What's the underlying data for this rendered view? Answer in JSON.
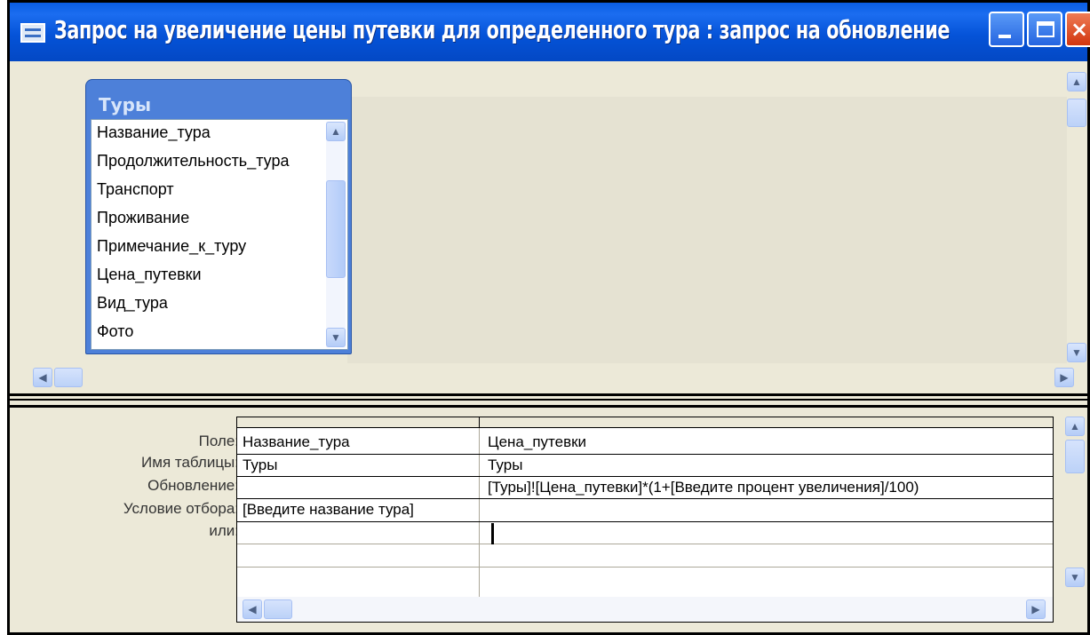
{
  "window": {
    "title": "Запрос на увеличение цены путевки для определенного тура : запрос на обновление",
    "controls": {
      "minimize": "minimize",
      "maximize": "maximize",
      "close": "×"
    }
  },
  "table_box": {
    "title": "Туры",
    "fields": [
      "Название_тура",
      "Продолжительность_тура",
      "Транспорт",
      "Проживание",
      "Примечание_к_туру",
      "Цена_путевки",
      "Вид_тура",
      "Фото"
    ]
  },
  "grid": {
    "row_labels": {
      "field": "Поле:",
      "table": "Имя таблицы:",
      "update": "Обновление:",
      "criteria": "Условие отбора:",
      "or": "или:"
    },
    "columns": [
      {
        "field": "Название_тура",
        "table": "Туры",
        "update": "",
        "criteria": "[Введите название тура]",
        "or": ""
      },
      {
        "field": "Цена_путевки",
        "table": "Туры",
        "update": "[Туры]![Цена_путевки]*(1+[Введите процент увеличения]/100)",
        "criteria": "",
        "or": ""
      }
    ]
  },
  "icons": {
    "window_icon": "query-window-icon",
    "scroll_up": "scroll-up-arrow-icon",
    "scroll_down": "scroll-down-arrow-icon",
    "scroll_left": "scroll-left-arrow-icon",
    "scroll_right": "scroll-right-arrow-icon"
  },
  "colors": {
    "titlebar": "#0553d8",
    "table_box": "#4d80d9",
    "window_bg": "#ece9d8",
    "close_button": "#d2360f"
  }
}
